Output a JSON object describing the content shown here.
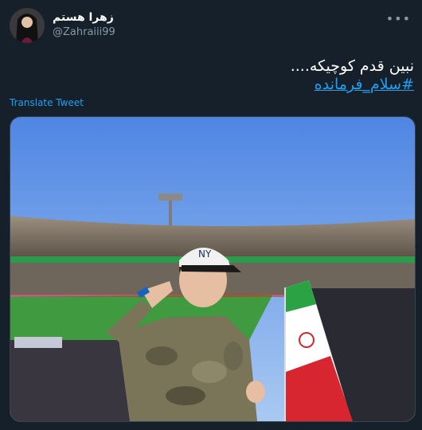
{
  "tweet": {
    "author_name": "زهرا هستم",
    "author_handle": "@Zahraiii99",
    "more_icon": "more-icon",
    "text_line1": "نبین قدم کوچیکه....",
    "hashtag": "#سلام_فرمانده",
    "translate_label": "Translate Tweet"
  },
  "colors": {
    "background": "#15202b",
    "link": "#1da1f2",
    "secondary_text": "#8899a6"
  },
  "media": {
    "kind": "photo",
    "icon": "photo"
  }
}
